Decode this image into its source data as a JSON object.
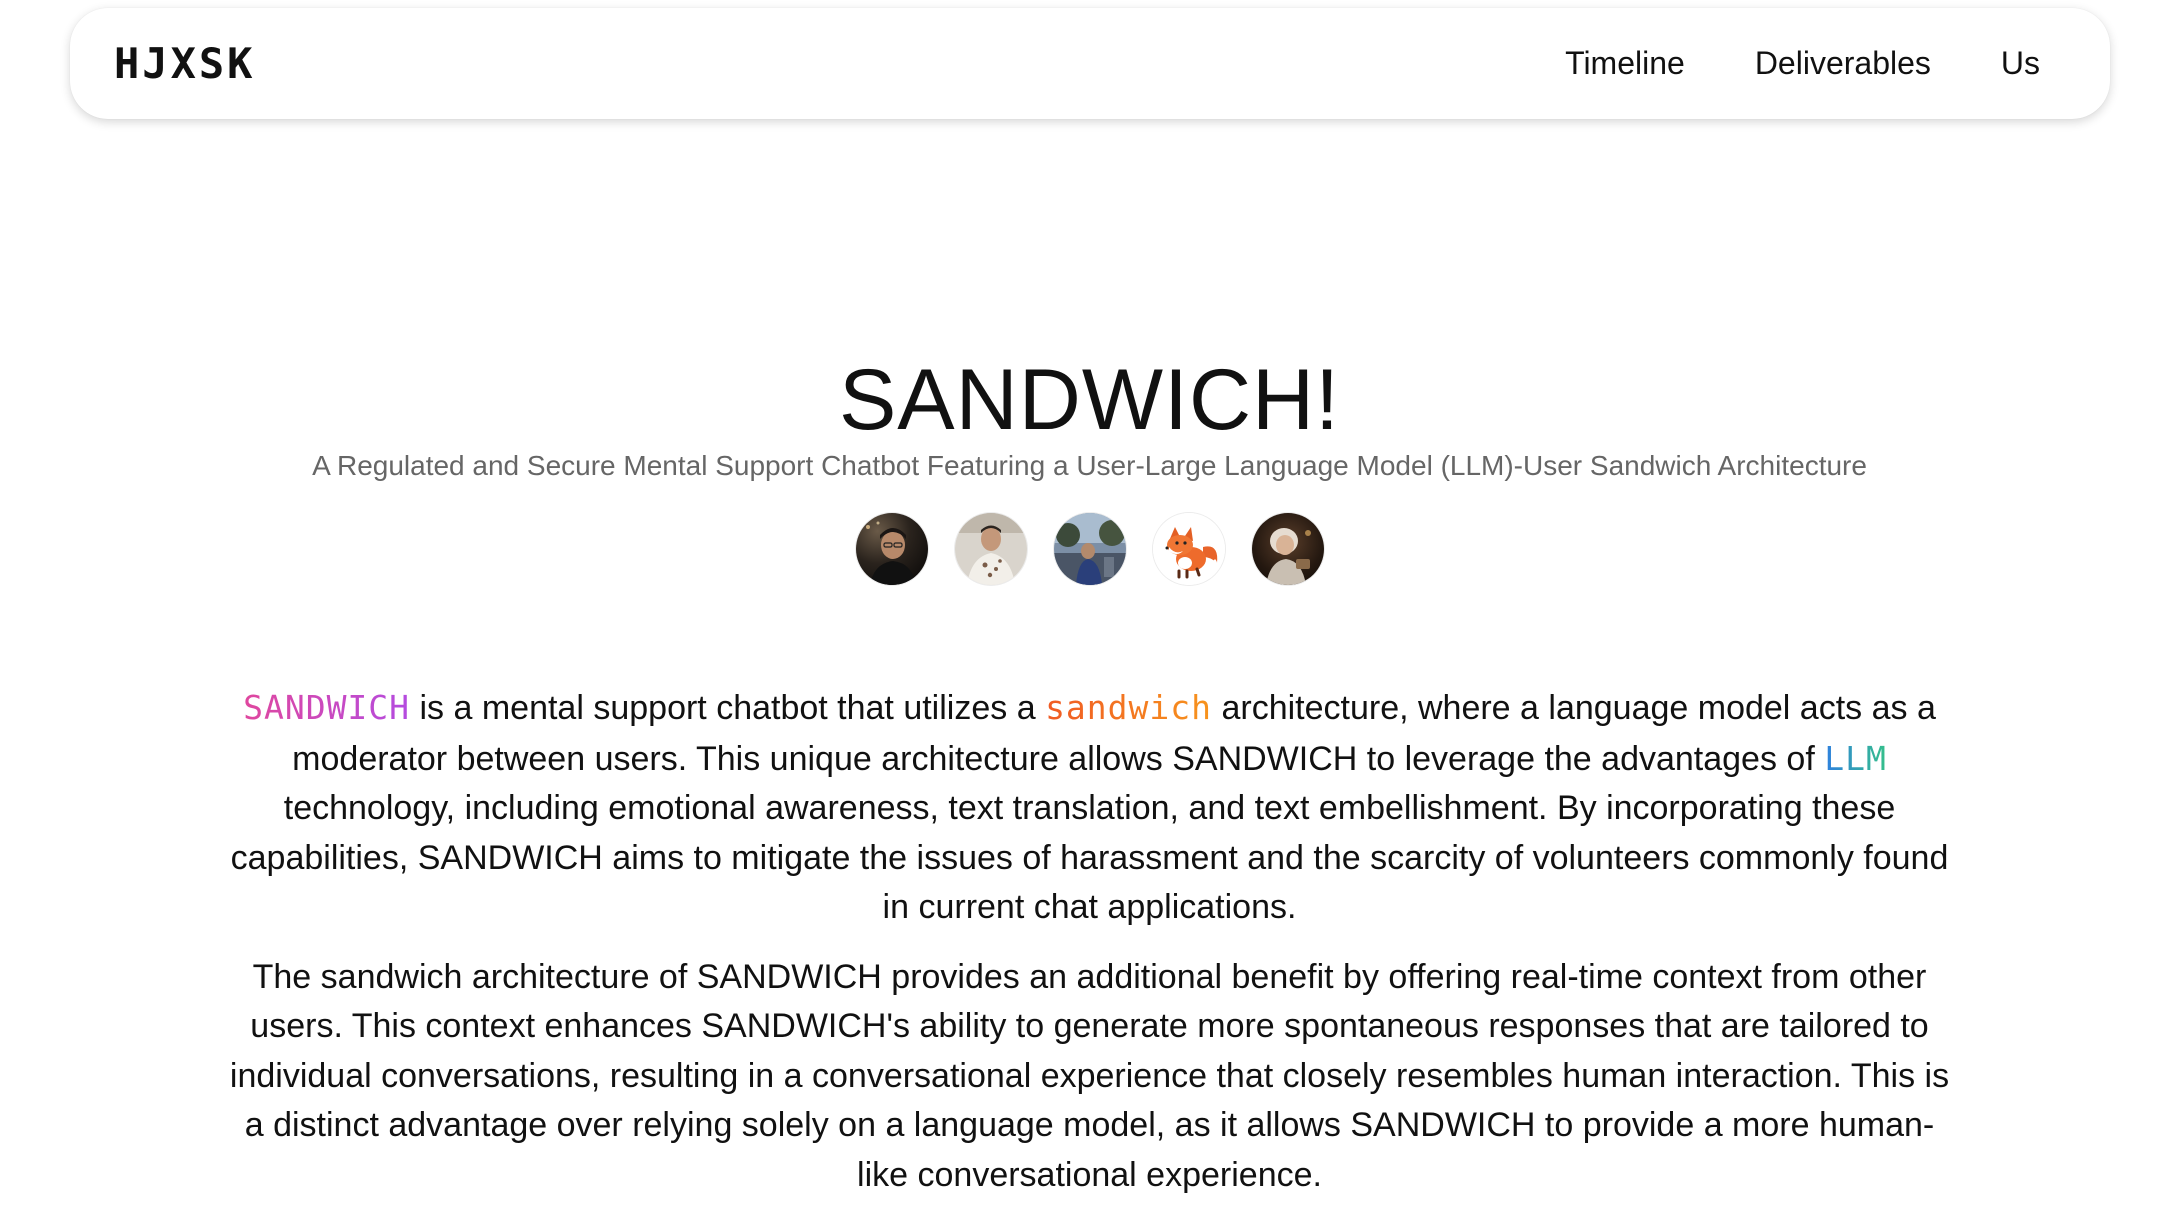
{
  "navbar": {
    "brand": "HJXSK",
    "links": [
      "Timeline",
      "Deliverables",
      "Us"
    ]
  },
  "hero": {
    "title": "SANDWICH!",
    "subtitle": "A Regulated and Secure Mental Support Chatbot Featuring a User-Large Language Model (LLM)-User Sandwich Architecture"
  },
  "avatars": [
    {
      "icon": "person-avatar-icon"
    },
    {
      "icon": "person-avatar-icon"
    },
    {
      "icon": "person-avatar-icon"
    },
    {
      "icon": "fox-avatar-icon"
    },
    {
      "icon": "person-avatar-icon"
    }
  ],
  "paragraph1": {
    "hl_sandwich_upper": "SANDWICH",
    "t1": " is a mental support chatbot that utilizes a ",
    "hl_sandwich_lower": "sandwich",
    "t2": " architecture, where a language model acts as a moderator between users. This unique architecture allows SANDWICH to leverage the advantages of ",
    "hl_llm": "LLM",
    "t3": " technology, including emotional awareness, text translation, and text embellishment. By incorporating these capabilities, SANDWICH aims to mitigate the issues of harassment and the scarcity of volunteers commonly found in current chat applications."
  },
  "paragraph2": {
    "text": "The sandwich architecture of SANDWICH provides an additional benefit by offering real-time context from other users. This context enhances SANDWICH's ability to generate more spontaneous responses that are tailored to individual conversations, resulting in a conversational experience that closely resembles human interaction. This is a distinct advantage over relying solely on a language model, as it allows SANDWICH to provide a more human-like conversational experience."
  },
  "colors": {
    "sandwich_upper": "#c048c4",
    "sandwich_lower": "#f26a1e",
    "llm_start": "#2f7fe0",
    "llm_end": "#35c08a",
    "subtitle": "#666666"
  }
}
